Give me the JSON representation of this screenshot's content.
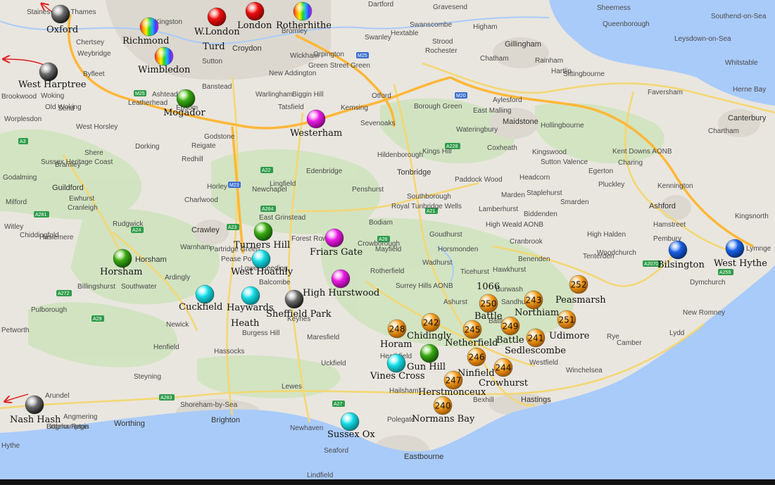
{
  "map": {
    "land_color": "#e9e6df",
    "sea_color": "#a9cbfa",
    "motorway_color": "#ffc34a",
    "primary_road_color": "#f7dc79",
    "sea_label": "",
    "places": [
      "Staines-upon-Thames",
      "Kingston",
      "Chertsey",
      "Weybridge",
      "Byfleet",
      "Brookwood",
      "Woking",
      "Old Woking",
      "Send",
      "Worplesdon",
      "West Horsley",
      "Leatherhead",
      "Ashtead",
      "Epsom",
      "Sutton",
      "Banstead",
      "Croydon",
      "Dartford",
      "Gravesend",
      "Sheerness",
      "Queenborough",
      "Southend-on-Sea",
      "Leysdown-on-Sea",
      "Herne Bay",
      "Whitstable",
      "Chatham",
      "Gillingham",
      "Rainham",
      "Hartlip",
      "Sittingbourne",
      "Faversham",
      "Canterbury",
      "Higham",
      "Strood",
      "Rochester",
      "Swanley",
      "Swanscombe",
      "Hextable",
      "Orpington",
      "Green Street Green",
      "Bromley",
      "Wickham",
      "New Addington",
      "Warlingham",
      "Biggin Hill",
      "Tatsfield",
      "Otford",
      "Borough Green",
      "Sevenoaks",
      "Kemsing",
      "East Malling",
      "Aylesford",
      "Maidstone",
      "Wateringbury",
      "Hollingbourne",
      "Kings Hill",
      "Coxheath",
      "Kingswood",
      "Sutton Valence",
      "Kent Downs AONB",
      "Charing",
      "Chartham",
      "Ashford",
      "Kennington",
      "Pluckley",
      "Egerton",
      "Smarden",
      "Headcorn",
      "Staplehurst",
      "Marden",
      "Paddock Wood",
      "Tonbridge",
      "Hildenborough",
      "Southborough",
      "Royal Tunbridge Wells",
      "Penshurst",
      "Edenbridge",
      "Lingfield",
      "Godstone",
      "Reigate",
      "Redhill",
      "Horley",
      "Charlwood",
      "Newchapel",
      "Crawley",
      "East Grinstead",
      "Forest Row",
      "Crowborough",
      "Mayfield",
      "Rotherfield",
      "Wadhurst",
      "Ticehurst",
      "Hawkhurst",
      "Cranbrook",
      "Benenden",
      "Tenterden",
      "Woodchurch",
      "High Halden",
      "Biddenden",
      "Hamstreet",
      "Dymchurch",
      "New Romney",
      "Lydd",
      "Rye",
      "Camber",
      "Winchelsea",
      "Hastings",
      "Bexhill",
      "Westfield",
      "Battle",
      "Heathfield",
      "Hailsham",
      "Polegate",
      "Eastbourne",
      "Seaford",
      "Newhaven",
      "Lewes",
      "Brighton",
      "Shoreham-by-Sea",
      "Worthing",
      "Littlehampton",
      "Angmering",
      "Arundel",
      "Steyning",
      "Henfield",
      "Hassocks",
      "Burgess Hill",
      "Uckfield",
      "Maresfield",
      "Horsham",
      "Southwater",
      "Billingshurst",
      "Pulborough",
      "Petworth",
      "Cranleigh",
      "Ewhurst",
      "Shere",
      "Dorking",
      "Bramley",
      "Godalming",
      "Guildford",
      "Milford",
      "Witley",
      "Chiddingfold",
      "Haslemere",
      "Rudgwick",
      "Warnham",
      "Pease Pottage",
      "Balcombe",
      "Keynes",
      "Newick",
      "Partridge Green",
      "Ardingly",
      "Lower Beeding",
      "Lindfield",
      "Sussex Heritage Coast",
      "Surrey Hills AONB",
      "High Weald AONB",
      "Goudhurst",
      "Lamberhurst",
      "Horsmonden",
      "Ashurst",
      "Burwash",
      "Sandhurst",
      "Bodiam",
      "Pembury",
      "Kingsnorth",
      "Lymnge",
      "Hythe",
      "Bognor Regis",
      "Littlehampton"
    ]
  },
  "markers": [
    {
      "label": "Oxford",
      "color": "grey",
      "style": "ball"
    },
    {
      "label": "Richmond",
      "color": "rainbow",
      "style": "ball"
    },
    {
      "label": "W.London Turd",
      "color": "red",
      "style": "ball"
    },
    {
      "label": "London",
      "color": "red",
      "style": "ball"
    },
    {
      "label": "Rotherhithe",
      "color": "rainbow",
      "style": "ball"
    },
    {
      "label": "Wimbledon",
      "color": "rainbow",
      "style": "ball"
    },
    {
      "label": "West Harptree",
      "color": "grey",
      "style": "ball"
    },
    {
      "label": "Mogador",
      "color": "green",
      "style": "ball"
    },
    {
      "label": "Westerham",
      "color": "magenta",
      "style": "ball"
    },
    {
      "label": "Turners Hill",
      "color": "green",
      "style": "ball"
    },
    {
      "label": "Friars Gate",
      "color": "magenta",
      "style": "ball"
    },
    {
      "label": "Horsham",
      "color": "green",
      "style": "ball"
    },
    {
      "label": "West Hoathly",
      "color": "cyan",
      "style": "ball"
    },
    {
      "label": "High Hurstwood",
      "color": "magenta",
      "style": "ball"
    },
    {
      "label": "Cuckfield",
      "color": "cyan",
      "style": "ball"
    },
    {
      "label": "Haywards Heath",
      "color": "cyan",
      "style": "ball"
    },
    {
      "label": "Sheffield Park",
      "color": "grey",
      "style": "ball"
    },
    {
      "label": "Bilsington",
      "color": "blue",
      "style": "ball"
    },
    {
      "label": "West Hythe",
      "color": "blue",
      "style": "ball"
    },
    {
      "label": "Horam",
      "color": "orange",
      "style": "numbered",
      "number": "248"
    },
    {
      "label": "Chidingly",
      "color": "orange",
      "style": "numbered",
      "number": "242"
    },
    {
      "label": "Netherfield",
      "color": "orange",
      "style": "numbered",
      "number": "245"
    },
    {
      "label": "1066 Battle",
      "color": "orange",
      "style": "numbered",
      "number": "250"
    },
    {
      "label": "Battle",
      "color": "orange",
      "style": "numbered",
      "number": "249"
    },
    {
      "label": "Northiam",
      "color": "orange",
      "style": "numbered",
      "number": "243"
    },
    {
      "label": "Peasmarsh",
      "color": "orange",
      "style": "numbered",
      "number": "252"
    },
    {
      "label": "Udimore",
      "color": "orange",
      "style": "numbered",
      "number": "251"
    },
    {
      "label": "Sedlescombe",
      "color": "orange",
      "style": "numbered",
      "number": "241"
    },
    {
      "label": "Gun Hill",
      "color": "green",
      "style": "ball"
    },
    {
      "label": "Vines Cross",
      "color": "cyan",
      "style": "ball"
    },
    {
      "label": "Ninfield",
      "color": "orange",
      "style": "numbered",
      "number": "246"
    },
    {
      "label": "Crowhurst",
      "color": "orange",
      "style": "numbered",
      "number": "244"
    },
    {
      "label": "Herstmonceux",
      "color": "orange",
      "style": "numbered",
      "number": "247"
    },
    {
      "label": "Normans Bay",
      "color": "orange",
      "style": "numbered",
      "number": "240"
    },
    {
      "label": "Nash Hash",
      "color": "grey",
      "style": "ball"
    },
    {
      "label": "Sussex Ox",
      "color": "cyan",
      "style": "ball"
    }
  ],
  "offmap_arrows": [
    {
      "target": "Oxford",
      "direction": "northwest"
    },
    {
      "target": "West Harptree",
      "direction": "west"
    },
    {
      "target": "Nash Hash",
      "direction": "west"
    }
  ],
  "road_shields": [
    "M25",
    "M25",
    "M20",
    "M23",
    "A23",
    "A22",
    "A264",
    "A26",
    "A21",
    "A228",
    "A2070",
    "A259",
    "A27",
    "A283",
    "A24",
    "A29",
    "A272",
    "A281",
    "A3"
  ]
}
